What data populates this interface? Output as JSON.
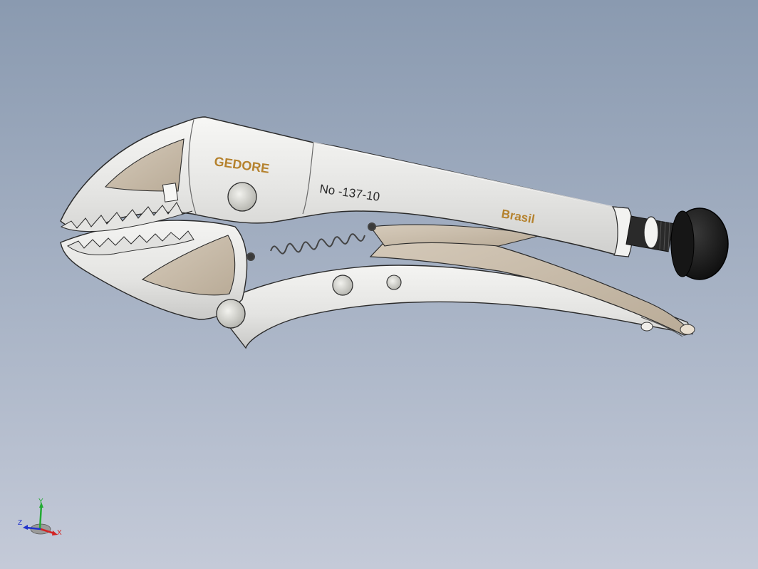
{
  "viewport": {
    "background_top": "#8a9ab0",
    "background_bottom": "#c4cad8"
  },
  "model": {
    "brand_label": "GEDORE",
    "part_number_label": "No -137-10",
    "origin_label": "Brasil",
    "brand_color": "#b5822e",
    "metal_color": "#e6e6e4",
    "inner_color": "#cbbfae",
    "knob_color": "#1c1c1c"
  },
  "triad": {
    "x_label": "X",
    "y_label": "Y",
    "z_label": "Z",
    "x_color": "#d22222",
    "y_color": "#22aa33",
    "z_color": "#2233cc"
  }
}
